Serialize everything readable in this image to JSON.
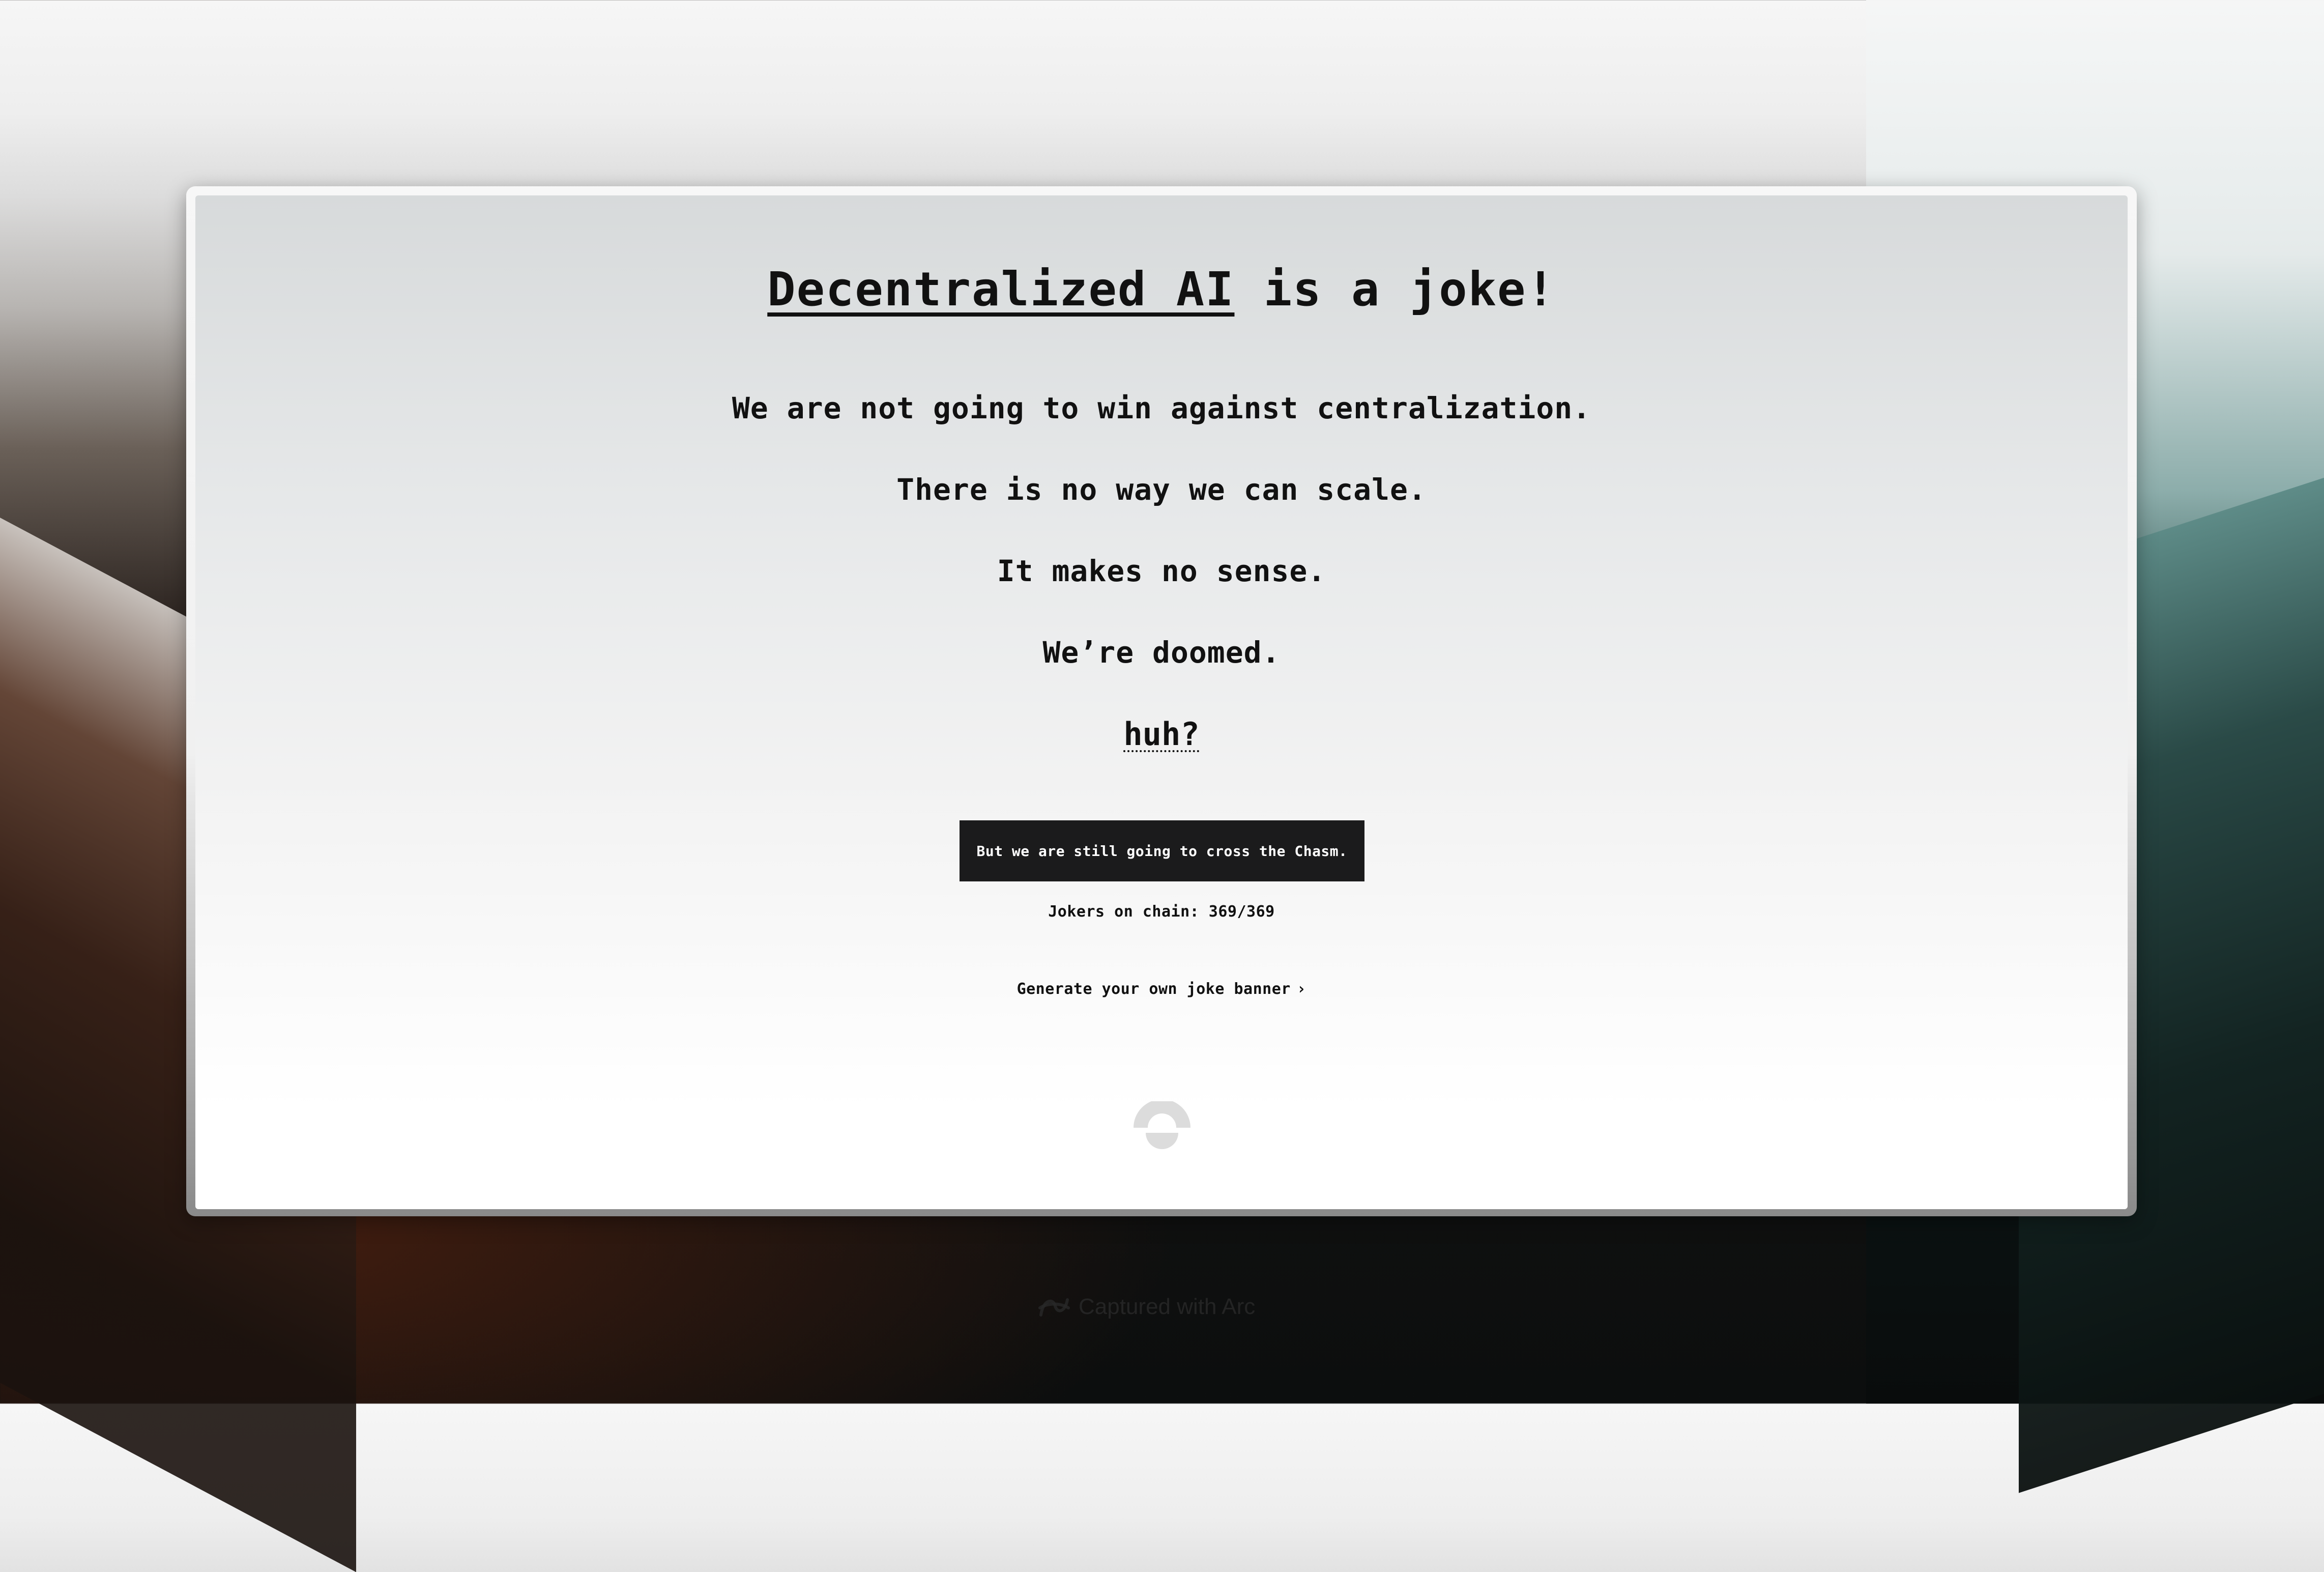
{
  "page": {
    "title_highlight": "Decentralized AI",
    "title_rest": " is a joke!",
    "lines": [
      "We are not going to win against centralization.",
      "There is no way we can scale.",
      "It makes no sense.",
      "We’re doomed."
    ],
    "huh_link": "huh?",
    "cta_button": "But we are still going to cross the Chasm.",
    "jokers_count": "Jokers on chain: 369/369",
    "generate_link": "Generate your own joke banner",
    "generate_chevron": "›"
  },
  "footer": {
    "captured_text": "Captured with Arc"
  },
  "colors": {
    "button_bg": "#1b1b1c",
    "button_text": "#ffffff",
    "text": "#111111"
  },
  "icons": {
    "logo": "semicircle-logo-icon",
    "arc": "arc-logo-icon"
  }
}
